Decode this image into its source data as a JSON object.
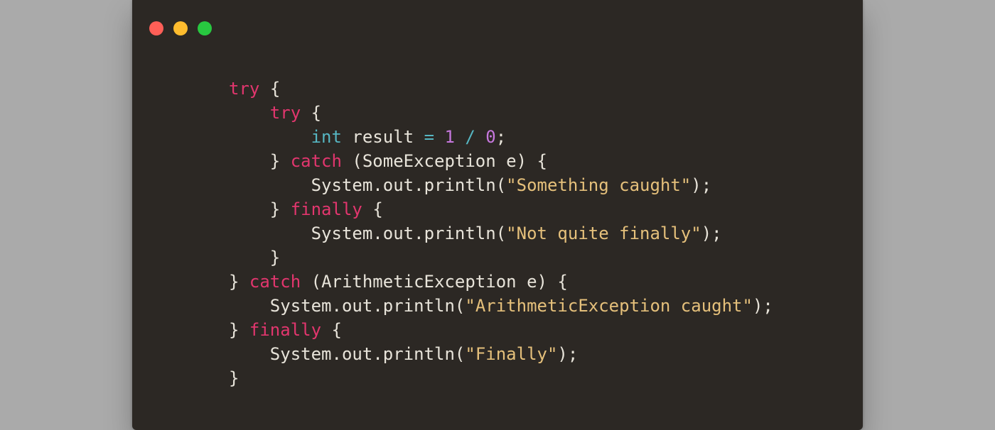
{
  "code": {
    "outer": {
      "try_kw": "try",
      "catch_kw": "catch",
      "finally_kw": "finally",
      "catch_exc_type": "ArithmeticException",
      "catch_exc_var": "e",
      "catch_body_obj": "System",
      "catch_body_field": "out",
      "catch_body_method": "println",
      "catch_body_string": "\"ArithmeticException caught\"",
      "finally_body_obj": "System",
      "finally_body_field": "out",
      "finally_body_method": "println",
      "finally_body_string": "\"Finally\""
    },
    "inner": {
      "try_kw": "try",
      "catch_kw": "catch",
      "finally_kw": "finally",
      "decl_type": "int",
      "decl_name": "result",
      "decl_eq": "=",
      "decl_lhs_num": "1",
      "decl_div": "/",
      "decl_rhs_num": "0",
      "catch_exc_type": "SomeException",
      "catch_exc_var": "e",
      "catch_body_obj": "System",
      "catch_body_field": "out",
      "catch_body_method": "println",
      "catch_body_string": "\"Something caught\"",
      "finally_body_obj": "System",
      "finally_body_field": "out",
      "finally_body_method": "println",
      "finally_body_string": "\"Not quite finally\""
    }
  },
  "glyphs": {
    "lbrace": "{",
    "rbrace": "}",
    "lparen": "(",
    "rparen": ")",
    "semi": ";",
    "dot": "."
  }
}
